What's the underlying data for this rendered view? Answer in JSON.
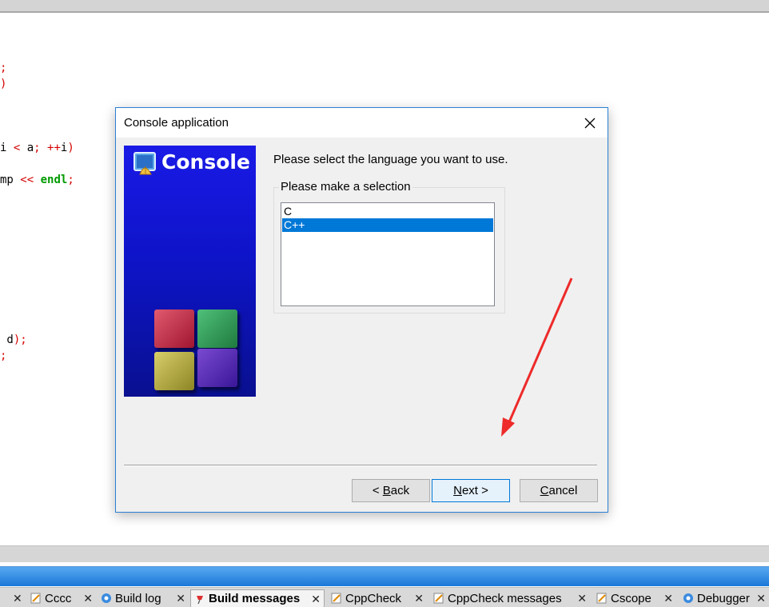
{
  "dialog": {
    "title": "Console application",
    "banner_title": "Console",
    "instruction": "Please select the language you want to use.",
    "group_label": "Please make a selection",
    "options": [
      "C",
      "C++"
    ],
    "selected": "C++",
    "buttons": {
      "back": "< Back",
      "next": "Next >",
      "cancel": "Cancel"
    }
  },
  "editor": {
    "lines": [
      {
        "parts": [
          ";"
        ]
      },
      {
        "parts": [
          ")"
        ]
      },
      {
        "parts": [
          "i ",
          "<",
          " a",
          ";",
          " ",
          "++",
          "i",
          ")"
        ]
      },
      {
        "parts": [
          "mp ",
          "<<",
          " ",
          "endl",
          ";"
        ]
      },
      {
        "parts": [
          " d",
          ")",
          ";"
        ]
      },
      {
        "parts": [
          ";"
        ]
      }
    ]
  },
  "bottom_tabs": [
    {
      "label": "Cccc",
      "icon": "note-icon"
    },
    {
      "label": "Build log",
      "icon": "gear-icon"
    },
    {
      "label": "Build messages",
      "icon": "pin-icon",
      "active": true
    },
    {
      "label": "CppCheck",
      "icon": "note-icon"
    },
    {
      "label": "CppCheck messages",
      "icon": "note-icon"
    },
    {
      "label": "Cscope",
      "icon": "note-icon"
    },
    {
      "label": "Debugger",
      "icon": "gear-icon"
    }
  ],
  "colors": {
    "accent": "#0078d7",
    "banner": "#1414d2",
    "code_red": "#d40000",
    "code_green": "#009a00"
  }
}
